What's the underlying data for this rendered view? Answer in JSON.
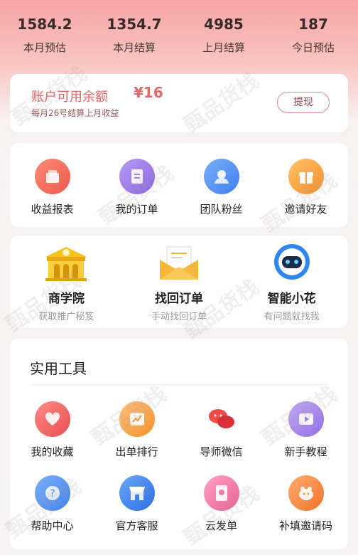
{
  "stats": [
    {
      "value": "1584.2",
      "label": "本月预估"
    },
    {
      "value": "1354.7",
      "label": "本月结算"
    },
    {
      "value": "4985",
      "label": "上月结算"
    },
    {
      "value": "187",
      "label": "今日预估"
    }
  ],
  "balance": {
    "title": "账户可用余额",
    "amount": "¥16",
    "note": "每月26号结算上月收益",
    "withdraw_label": "提现"
  },
  "main_menu": [
    {
      "label": "收益报表",
      "icon": "report-icon",
      "color": "#f0695a"
    },
    {
      "label": "我的订单",
      "icon": "order-icon",
      "color": "#9b7ce8"
    },
    {
      "label": "团队粉丝",
      "icon": "team-icon",
      "color": "#4e8ef0"
    },
    {
      "label": "邀请好友",
      "icon": "gift-icon",
      "color": "#f8a23a"
    }
  ],
  "features": [
    {
      "title": "商学院",
      "subtitle": "获取推广秘笈",
      "icon": "school-icon"
    },
    {
      "title": "找回订单",
      "subtitle": "手动找回订单",
      "icon": "envelope-icon"
    },
    {
      "title": "智能小花",
      "subtitle": "有问题就找我",
      "icon": "robot-icon"
    }
  ],
  "tools": {
    "title": "实用工具",
    "row1": [
      {
        "label": "我的收藏",
        "icon": "heart-icon",
        "color": "#f0625f"
      },
      {
        "label": "出单排行",
        "icon": "trend-icon",
        "color": "#f6a14a"
      },
      {
        "label": "导师微信",
        "icon": "chat-icon",
        "color": "#e84a4a"
      },
      {
        "label": "新手教程",
        "icon": "play-icon",
        "color": "#a47ce8"
      }
    ],
    "row2": [
      {
        "label": "帮助中心",
        "icon": "help-icon",
        "color": "#4d8ff0"
      },
      {
        "label": "官方客服",
        "icon": "store-icon",
        "color": "#3f7ff0"
      },
      {
        "label": "云发单",
        "icon": "cloud-send-icon",
        "color": "#f07aa6"
      },
      {
        "label": "补填邀请码",
        "icon": "piggy-icon",
        "color": "#f5883c"
      }
    ]
  },
  "watermark": "甄品货栈"
}
